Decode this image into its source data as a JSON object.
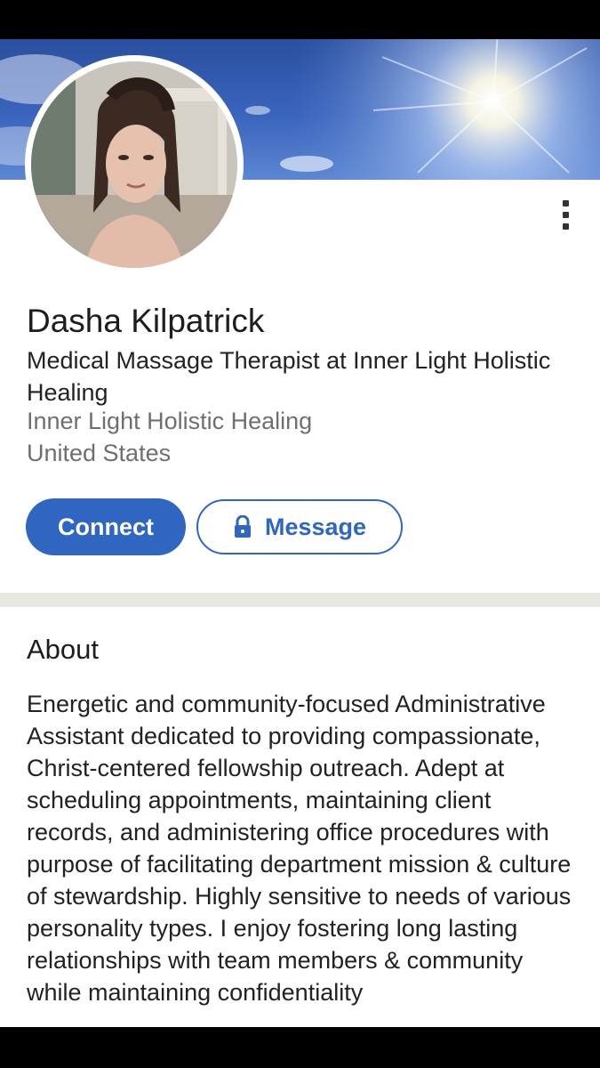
{
  "profile": {
    "name": "Dasha Kilpatrick",
    "headline": "Medical Massage Therapist at Inner Light Holistic Healing",
    "company": "Inner Light Holistic Healing",
    "location": "United States"
  },
  "actions": {
    "connect_label": "Connect",
    "message_label": "Message"
  },
  "about": {
    "title": "About",
    "text": "Energetic and community-focused Administrative Assistant dedicated to providing compassionate, Christ-centered fellowship outreach. Adept at scheduling appointments, maintaining client records, and administering office procedures with purpose of facilitating department mission & culture of stewardship. Highly sensitive to needs of various personality types. I enjoy fostering long lasting relationships with team members & community while maintaining confidentiality"
  },
  "icons": {
    "more": "more-vertical-icon",
    "lock": "lock-icon"
  },
  "colors": {
    "accent": "#2e66c2",
    "text_primary": "#1d1d1d",
    "text_secondary": "#6f6f6f",
    "divider": "#e9e7e2"
  }
}
